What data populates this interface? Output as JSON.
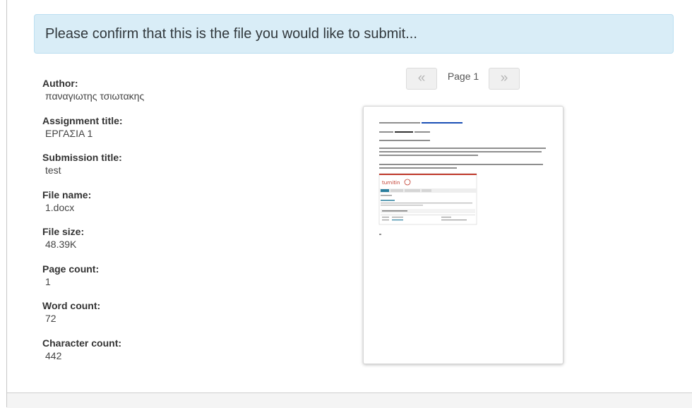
{
  "banner": {
    "message": "Please confirm that this is the file you would like to submit..."
  },
  "details": [
    {
      "label": "Author:",
      "value": "παναγιωτης τσιωτακης"
    },
    {
      "label": "Assignment title:",
      "value": "ΕΡΓΑΣΙΑ 1"
    },
    {
      "label": "Submission title:",
      "value": "test"
    },
    {
      "label": "File name:",
      "value": "1.docx"
    },
    {
      "label": "File size:",
      "value": "48.39K"
    },
    {
      "label": "Page count:",
      "value": "1"
    },
    {
      "label": "Word count:",
      "value": "72"
    },
    {
      "label": "Character count:",
      "value": "442"
    }
  ],
  "pager": {
    "prev_label": "«",
    "next_label": "»",
    "page_label": "Page 1"
  },
  "preview": {
    "icon": "document-thumbnail",
    "brand_color": "#c0392b",
    "link_color": "#1a4fb5"
  }
}
